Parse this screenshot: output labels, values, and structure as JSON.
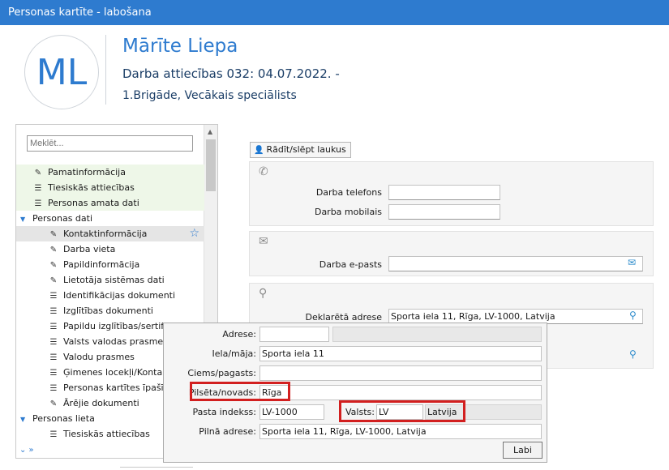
{
  "window": {
    "title": "Personas kartīte - labošana"
  },
  "header": {
    "initials": "ML",
    "name": "Mārīte Liepa",
    "employment": "Darba attiecības 032: 04.07.2022. -",
    "position": "1.Brigāde, Vecākais speciālists"
  },
  "nav": {
    "search_placeholder": "Meklēt...",
    "items": [
      {
        "label": "Pamatinformācija",
        "icon": "edit-icon"
      },
      {
        "label": "Tiesiskās attiecības",
        "icon": "table-icon"
      },
      {
        "label": "Personas amata dati",
        "icon": "table-icon"
      },
      {
        "label": "Personas dati",
        "icon": "chevron-down-icon"
      },
      {
        "label": "Kontaktinformācija",
        "icon": "edit-icon"
      },
      {
        "label": "Darba vieta",
        "icon": "edit-icon"
      },
      {
        "label": "Papildinformācija",
        "icon": "edit-icon"
      },
      {
        "label": "Lietotāja sistēmas dati",
        "icon": "edit-icon"
      },
      {
        "label": "Identifikācijas dokumenti",
        "icon": "table-icon"
      },
      {
        "label": "Izglītības dokumenti",
        "icon": "table-icon"
      },
      {
        "label": "Papildu izglītības/sertifikāti",
        "icon": "table-icon"
      },
      {
        "label": "Valsts valodas prasmes",
        "icon": "table-icon"
      },
      {
        "label": "Valodu prasmes",
        "icon": "table-icon"
      },
      {
        "label": "Ģimenes locekļi/Kontaktpersonas",
        "icon": "table-icon"
      },
      {
        "label": "Personas kartītes īpašības",
        "icon": "table-icon"
      },
      {
        "label": "Ārējie dokumenti",
        "icon": "edit-icon"
      },
      {
        "label": "Personas lieta",
        "icon": "chevron-down-icon"
      },
      {
        "label": "Tiesiskās attiecības",
        "icon": "table-icon"
      }
    ]
  },
  "toolbar": {
    "toggle_fields_label": "Rādīt/slēpt laukus"
  },
  "phone": {
    "work_phone_label": "Darba telefons",
    "work_phone_value": "",
    "work_mobile_label": "Darba mobilais",
    "work_mobile_value": ""
  },
  "email": {
    "work_email_label": "Darba e-pasts",
    "work_email_value": ""
  },
  "address": {
    "declared_label": "Deklarētā adrese",
    "declared_value": "Sporta iela 11, Rīga, LV-1000, Latvija"
  },
  "popup": {
    "address_label": "Adrese:",
    "address_value": "",
    "street_label": "Iela/māja:",
    "street_value": "Sporta iela 11",
    "village_label": "Ciems/pagasts:",
    "village_value": "",
    "city_label": "Pilsēta/novads:",
    "city_value": "Rīga",
    "postcode_label": "Pasta indekss:",
    "postcode_value": "LV-1000",
    "country_label": "Valsts:",
    "country_code": "LV",
    "country_name": "Latvija",
    "full_label": "Pilnā adrese:",
    "full_value": "Sporta iela 11, Rīga, LV-1000, Latvija",
    "ok_label": "Labi"
  }
}
